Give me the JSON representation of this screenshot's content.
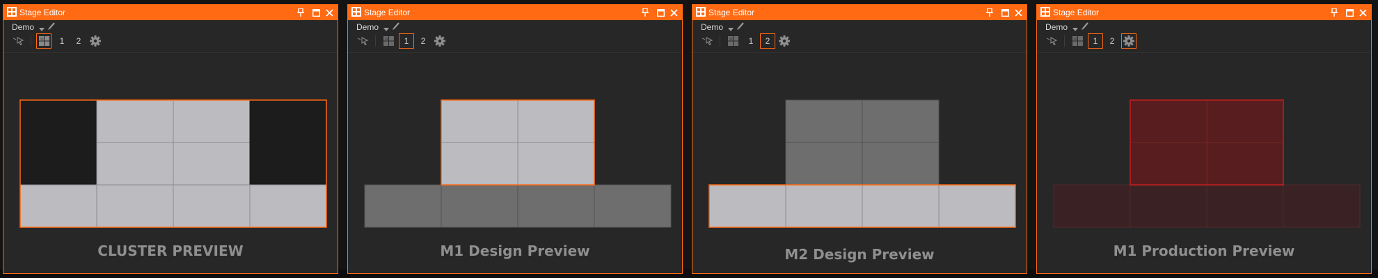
{
  "colors": {
    "accent": "#ff6a13",
    "panel_bg": "#272727",
    "tile_light": "#bcbbbf",
    "tile_dark_gray": "#6e6e6e",
    "tile_dark": "#1c1c1c",
    "red_bright": "#581d1e",
    "red_dim": "#3a2224"
  },
  "panels": [
    {
      "title": "Stage Editor",
      "dropdown": "Demo",
      "btn1": "1",
      "btn2": "2",
      "selected": "grid",
      "caption": "CLUSTER PREVIEW",
      "grid": [
        "dark",
        "light",
        "light",
        "dark",
        "dark",
        "light",
        "light",
        "dark",
        "light",
        "light",
        "light",
        "light"
      ],
      "outline": "full",
      "outline_color": "#ff6a13"
    },
    {
      "title": "Stage Editor",
      "dropdown": "Demo",
      "btn1": "1",
      "btn2": "2",
      "selected": "one",
      "caption": "M1 Design Preview",
      "grid": [
        "none",
        "light",
        "light",
        "none",
        "none",
        "light",
        "light",
        "none",
        "gray",
        "gray",
        "gray",
        "gray"
      ],
      "outline": "top",
      "outline_color": "#ff6a13"
    },
    {
      "title": "Stage Editor",
      "dropdown": "Demo",
      "btn1": "1",
      "btn2": "2",
      "selected": "two",
      "caption": "M2 Design Preview",
      "grid": [
        "none",
        "gray",
        "gray",
        "none",
        "none",
        "gray",
        "gray",
        "none",
        "light",
        "light",
        "light",
        "light"
      ],
      "outline": "bottom",
      "outline_color": "#ff6a13"
    },
    {
      "title": "Stage Editor",
      "dropdown": "Demo",
      "btn1": "1",
      "btn2": "2",
      "selected": "one+gear",
      "caption": "M1 Production Preview",
      "grid": [
        "none",
        "red",
        "red",
        "none",
        "none",
        "red",
        "red",
        "none",
        "reddim",
        "reddim",
        "reddim",
        "reddim"
      ],
      "outline": "top",
      "outline_color": "#c41f1f"
    }
  ]
}
